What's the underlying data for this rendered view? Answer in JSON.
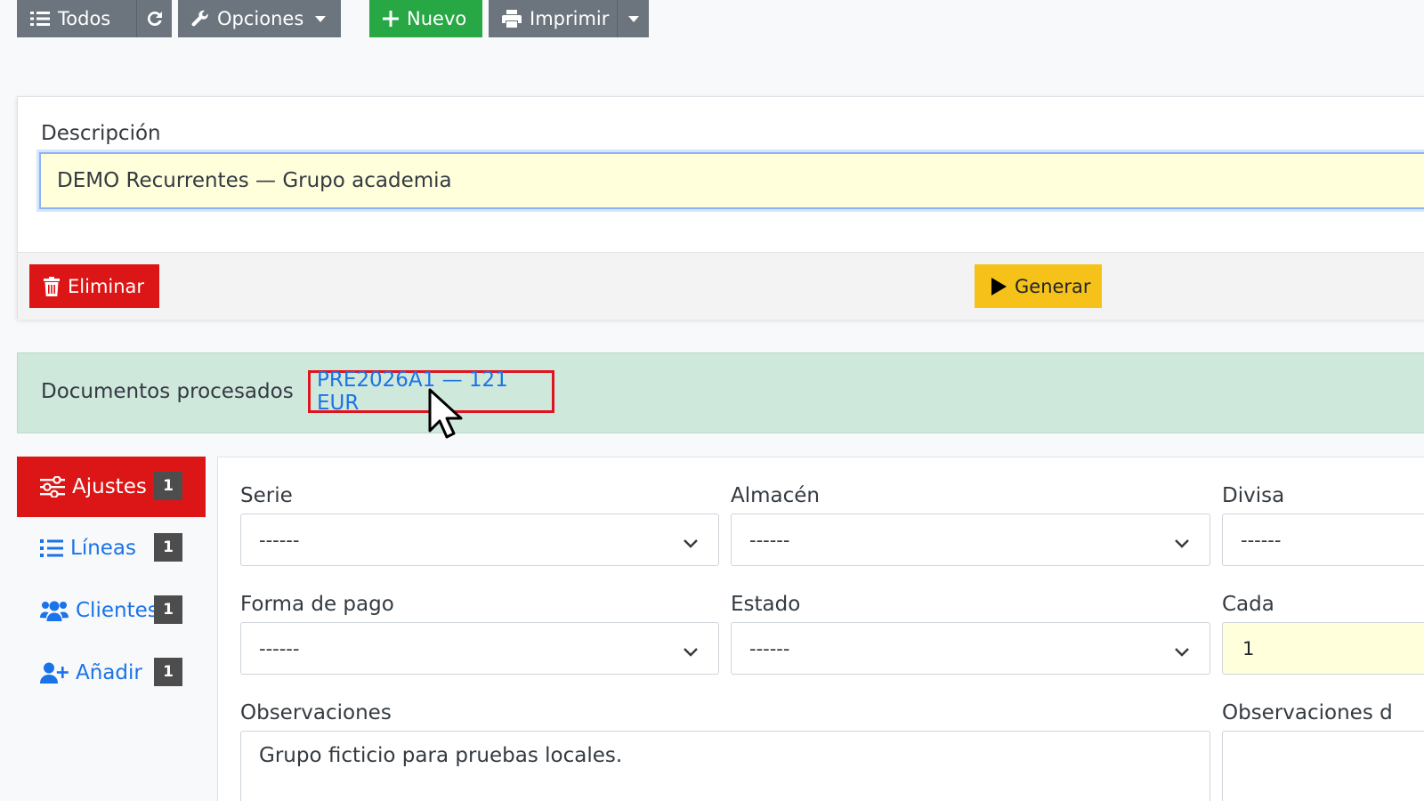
{
  "toolbar": {
    "todos_label": "Todos",
    "opciones_label": "Opciones",
    "nuevo_label": "Nuevo",
    "imprimir_label": "Imprimir"
  },
  "card": {
    "descripcion_label": "Descripción",
    "descripcion_value": "DEMO Recurrentes — Grupo academia",
    "eliminar_label": "Eliminar",
    "generar_label": "Generar"
  },
  "alert": {
    "label": "Documentos procesados",
    "link": "PRE2026A1 — 121 EUR"
  },
  "sidebar": {
    "items": [
      {
        "label": "Ajustes",
        "badge": "1"
      },
      {
        "label": "Líneas",
        "badge": "1"
      },
      {
        "label": "Clientes",
        "badge": "1"
      },
      {
        "label": "Añadir",
        "badge": "1"
      }
    ]
  },
  "form": {
    "serie_label": "Serie",
    "serie_value": "------",
    "almacen_label": "Almacén",
    "almacen_value": "------",
    "divisa_label": "Divisa",
    "divisa_value": "------",
    "forma_pago_label": "Forma de pago",
    "forma_pago_value": "------",
    "estado_label": "Estado",
    "estado_value": "------",
    "cada_label": "Cada",
    "cada_value": "1",
    "observaciones_label": "Observaciones",
    "observaciones_value": "Grupo ficticio para pruebas locales.",
    "observaciones_d_label": "Observaciones d"
  },
  "colors": {
    "danger": "#dc1616",
    "success": "#28a745",
    "warning": "#f6c21a",
    "secondary": "#6c757d",
    "link": "#1a73e8",
    "highlight_box": "#e0141f"
  },
  "icons": [
    "list-icon",
    "refresh-icon",
    "wrench-icon",
    "plus-icon",
    "printer-icon",
    "trash-icon",
    "play-icon",
    "sliders-icon",
    "users-icon",
    "user-plus-icon",
    "chevron-down-icon",
    "mouse-cursor-icon"
  ]
}
